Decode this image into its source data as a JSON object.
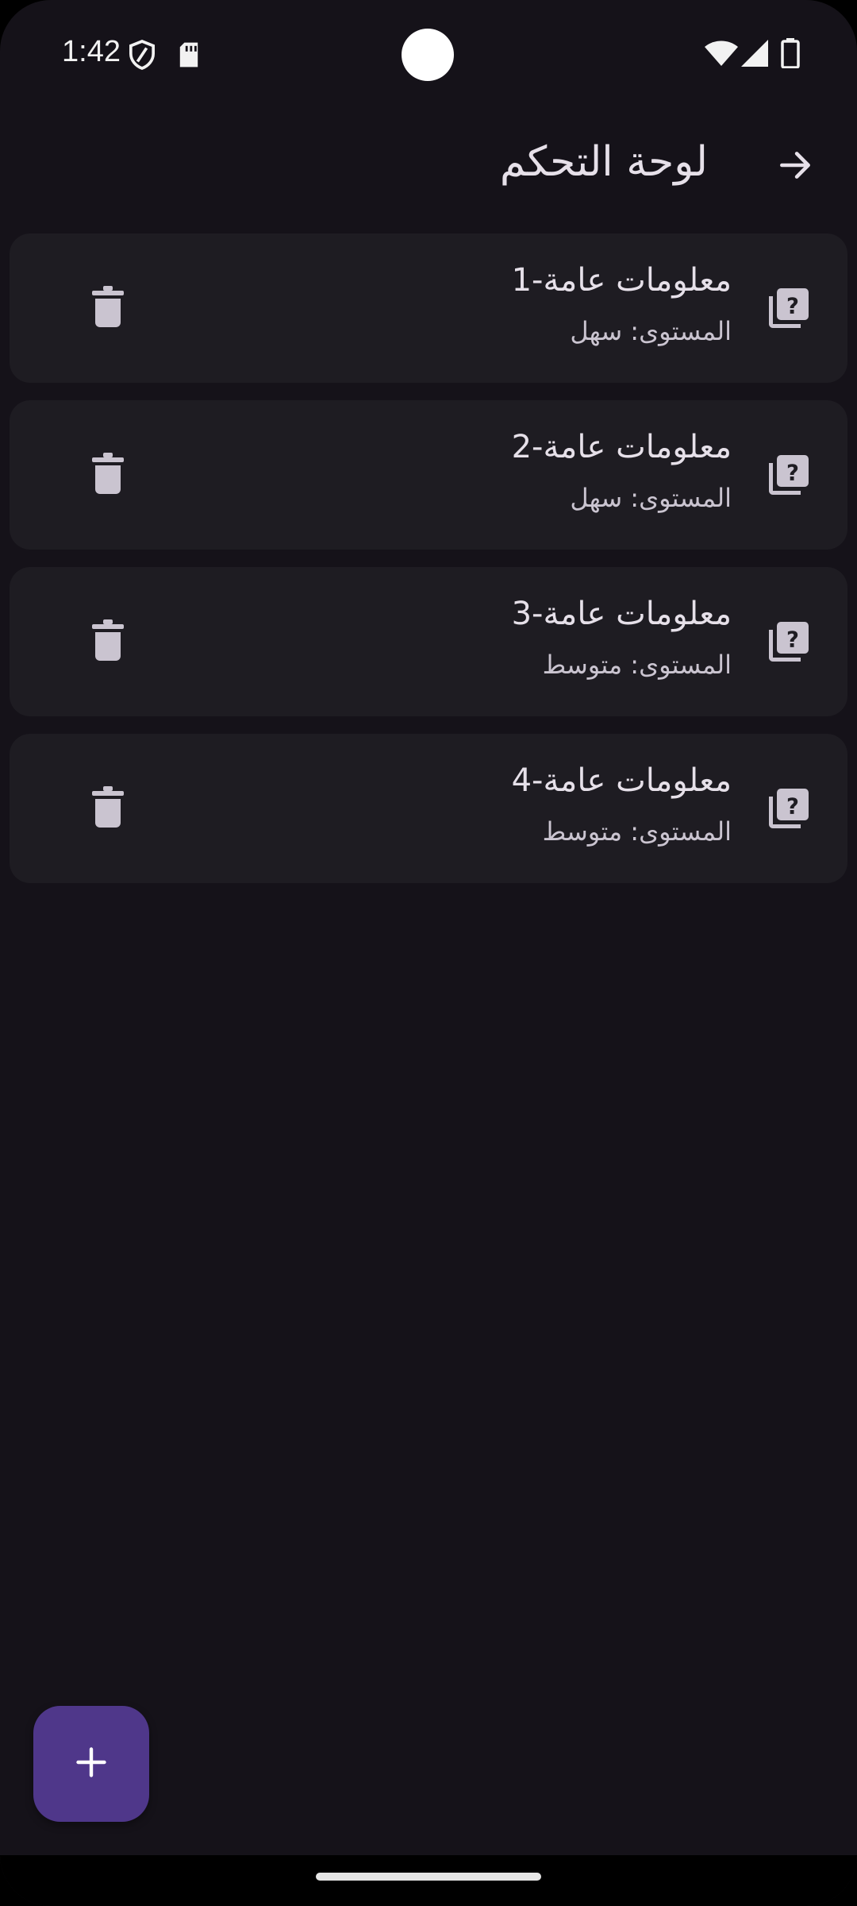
{
  "status_bar": {
    "time": "1:42",
    "icons": [
      "shield-icon",
      "sd-card-icon",
      "wifi-icon",
      "signal-icon",
      "battery-icon"
    ]
  },
  "app_bar": {
    "title": "لوحة التحكم",
    "back_icon": "arrow-forward-icon"
  },
  "quizzes": [
    {
      "title": "معلومات عامة-1",
      "level": "المستوى: سهل",
      "icon": "quiz-icon",
      "delete_icon": "delete-icon"
    },
    {
      "title": "معلومات عامة-2",
      "level": "المستوى: سهل",
      "icon": "quiz-icon",
      "delete_icon": "delete-icon"
    },
    {
      "title": "معلومات عامة-3",
      "level": "المستوى: متوسط",
      "icon": "quiz-icon",
      "delete_icon": "delete-icon"
    },
    {
      "title": "معلومات عامة-4",
      "level": "المستوى: متوسط",
      "icon": "quiz-icon",
      "delete_icon": "delete-icon"
    }
  ],
  "fab": {
    "icon": "add-icon"
  },
  "colors": {
    "background": "#151219",
    "card": "#1e1c22",
    "fab": "#4f378a",
    "on_surface": "#e6e0e9",
    "on_surface_variant": "#cac4d0",
    "icon_tint": "#cac4d0"
  }
}
